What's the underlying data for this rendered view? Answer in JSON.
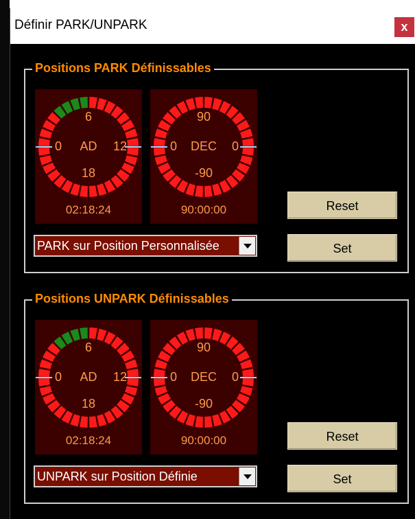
{
  "window": {
    "title": "Définir PARK/UNPARK",
    "close_glyph": "x"
  },
  "sections": [
    {
      "label": "Positions PARK Définissables",
      "ra": {
        "top": "6",
        "left": "0",
        "name": "AD",
        "right": "12",
        "bottom": "18",
        "time": "02:18:24",
        "green_sectors": 4
      },
      "dec": {
        "top": "90",
        "left": "0",
        "name": "DEC",
        "right": "0",
        "bottom": "-90",
        "time": "90:00:00",
        "green_sectors": 0
      },
      "combo_value": "PARK sur Position Personnalisée",
      "reset_label": "Reset",
      "set_label": "Set"
    },
    {
      "label": "Positions UNPARK Définissables",
      "ra": {
        "top": "6",
        "left": "0",
        "name": "AD",
        "right": "12",
        "bottom": "18",
        "time": "02:18:24",
        "green_sectors": 4
      },
      "dec": {
        "top": "90",
        "left": "0",
        "name": "DEC",
        "right": "0",
        "bottom": "-90",
        "time": "90:00:00",
        "green_sectors": 0
      },
      "combo_value": "UNPARK sur Position Définie",
      "reset_label": "Reset",
      "set_label": "Set"
    }
  ],
  "colors": {
    "ring_red": "#ff1a1a",
    "ring_green": "#1a8a1a",
    "panel_bg": "#3b0000",
    "text_orange": "#ff9a4a",
    "label_orange": "#ff8c00",
    "button_tan": "#d7cca6"
  }
}
